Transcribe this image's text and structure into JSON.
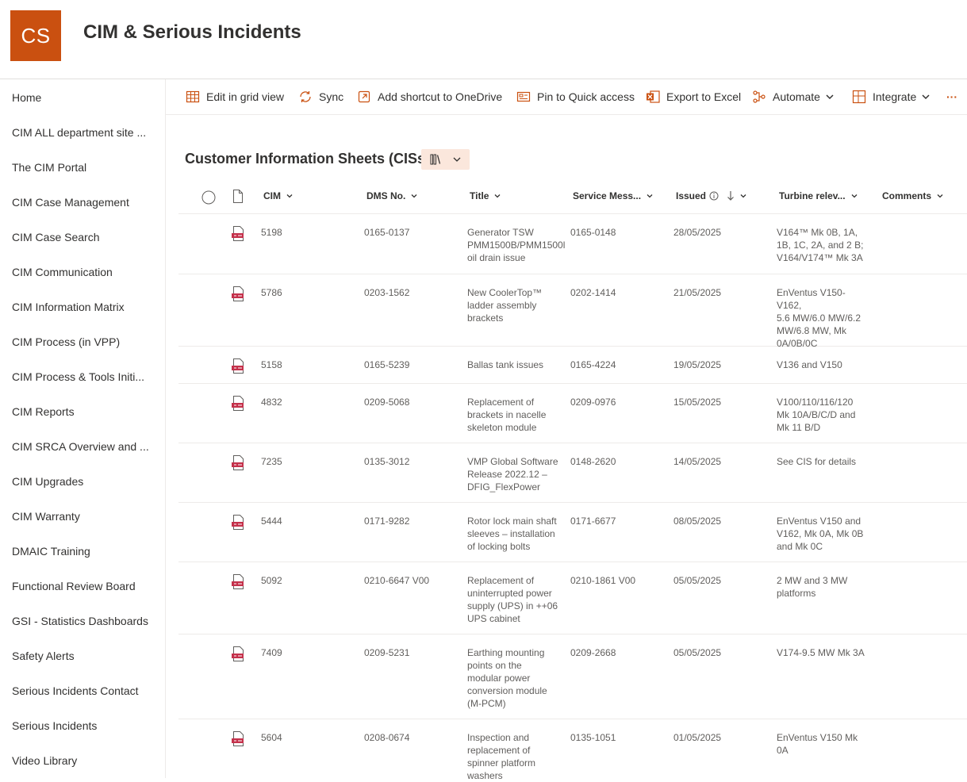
{
  "site": {
    "logo_text": "CS",
    "title": "CIM & Serious Incidents",
    "brand_color": "#ca5010"
  },
  "nav": {
    "items": [
      "Home",
      "CIM ALL department site ...",
      "The CIM Portal",
      "CIM Case Management",
      "CIM Case Search",
      "CIM Communication",
      "CIM Information Matrix",
      "CIM Process (in VPP)",
      "CIM Process & Tools Initi...",
      "CIM Reports",
      "CIM SRCA Overview and ...",
      "CIM Upgrades",
      "CIM Warranty",
      "DMAIC Training",
      "Functional Review Board",
      "GSI - Statistics Dashboards",
      "Safety Alerts",
      "Serious Incidents Contact",
      "Serious Incidents",
      "Video Library"
    ]
  },
  "commands": {
    "edit_grid": "Edit in grid view",
    "sync": "Sync",
    "add_shortcut": "Add shortcut to OneDrive",
    "pin_quick": "Pin to Quick access",
    "export_excel": "Export to Excel",
    "automate": "Automate",
    "integrate": "Integrate",
    "more": "···"
  },
  "library": {
    "title": "Customer Information Sheets (CISs)"
  },
  "columns": {
    "cim": "CIM",
    "dms": "DMS No.",
    "title": "Title",
    "service": "Service Mess...",
    "issued": "Issued",
    "turbine": "Turbine relev...",
    "comments": "Comments"
  },
  "rows": [
    {
      "cim": "5198",
      "dms": "0165-0137",
      "title": [
        "Generator TSW",
        "PMM1500B/PMM1500l",
        "oil drain issue"
      ],
      "service": "0165-0148",
      "issued": "28/05/2025",
      "turbine": [
        "V164™ Mk 0B, 1A,",
        "1B, 1C, 2A, and 2 B;",
        "V164/V174™ Mk 3A"
      ]
    },
    {
      "cim": "5786",
      "dms": "0203-1562",
      "title": [
        "New CoolerTop™",
        "ladder assembly",
        "brackets"
      ],
      "service": "0202-1414",
      "issued": "21/05/2025",
      "turbine": [
        "EnVentus V150-V162,",
        "5.6 MW/6.0 MW/6.2",
        "MW/6.8 MW, Mk",
        "0A/0B/0C"
      ]
    },
    {
      "cim": "5158",
      "dms": "0165-5239",
      "title": [
        "Ballas tank issues"
      ],
      "service": "0165-4224",
      "issued": "19/05/2025",
      "turbine": [
        "V136 and V150"
      ]
    },
    {
      "cim": "4832",
      "dms": "0209-5068",
      "title": [
        "Replacement of",
        "brackets in nacelle",
        "skeleton module"
      ],
      "service": "0209-0976",
      "issued": "15/05/2025",
      "turbine": [
        "V100/110/116/120",
        "Mk 10A/B/C/D and",
        "Mk 11 B/D"
      ]
    },
    {
      "cim": "7235",
      "dms": "0135-3012",
      "title": [
        "VMP Global Software",
        "Release 2022.12 –",
        "DFIG_FlexPower"
      ],
      "service": "0148-2620",
      "issued": "14/05/2025",
      "turbine": [
        "See CIS for details"
      ]
    },
    {
      "cim": "5444",
      "dms": "0171-9282",
      "title": [
        "Rotor lock main shaft",
        "sleeves – installation",
        "of locking bolts"
      ],
      "service": "0171-6677",
      "issued": "08/05/2025",
      "turbine": [
        "EnVentus V150 and",
        "V162, Mk 0A, Mk 0B",
        "and Mk 0C"
      ]
    },
    {
      "cim": "5092",
      "dms": "0210-6647 V00",
      "title": [
        "Replacement of",
        "uninterrupted power",
        "supply (UPS) in ++06",
        "UPS cabinet"
      ],
      "service": "0210-1861 V00",
      "issued": "05/05/2025",
      "turbine": [
        "2 MW and 3 MW",
        "platforms"
      ]
    },
    {
      "cim": "7409",
      "dms": "0209-5231",
      "title": [
        "Earthing mounting",
        "points on the",
        "modular power",
        "conversion module",
        "(M-PCM)"
      ],
      "service": "0209-2668",
      "issued": "05/05/2025",
      "turbine": [
        "V174-9.5 MW Mk 3A"
      ]
    },
    {
      "cim": "5604",
      "dms": "0208-0674",
      "title": [
        "Inspection and",
        "replacement of",
        "spinner platform",
        "washers"
      ],
      "service": "0135-1051",
      "issued": "01/05/2025",
      "turbine": [
        "EnVentus V150 Mk",
        "0A"
      ]
    }
  ]
}
